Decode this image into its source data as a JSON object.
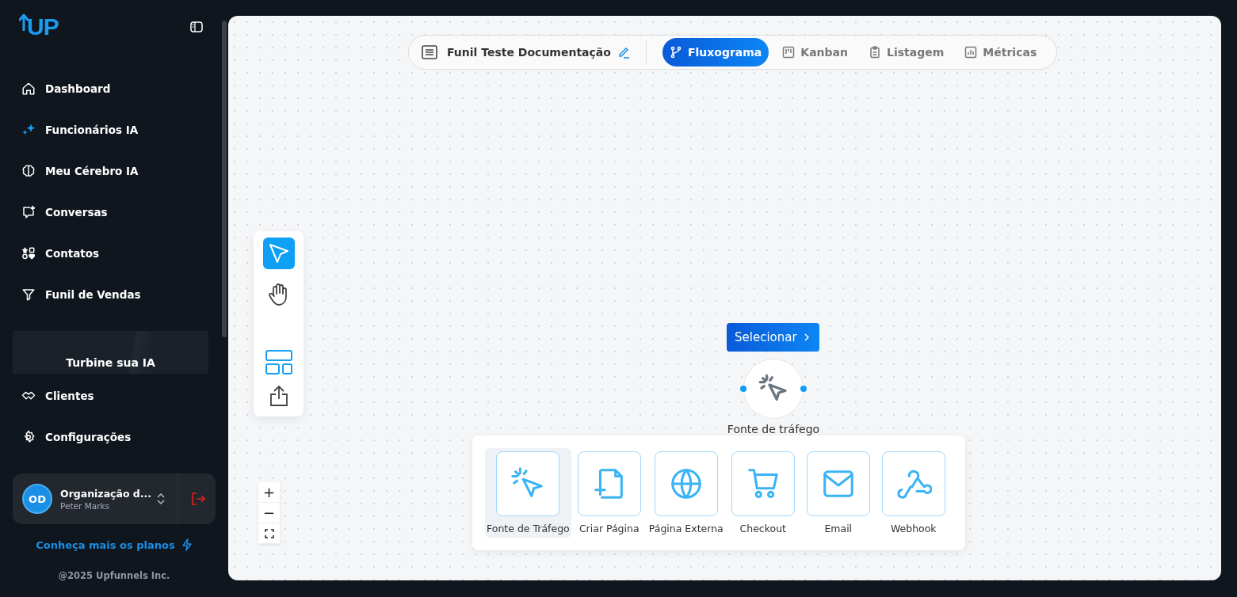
{
  "sidebar": {
    "logo": "UP",
    "items": [
      {
        "label": "Dashboard"
      },
      {
        "label": "Funcionários IA"
      },
      {
        "label": "Meu Cérebro IA"
      },
      {
        "label": "Conversas"
      },
      {
        "label": "Contatos"
      },
      {
        "label": "Funil de Vendas"
      }
    ],
    "promo": {
      "title": "Turbine sua IA"
    },
    "bottom_items": [
      {
        "label": "Clientes"
      },
      {
        "label": "Configurações"
      }
    ],
    "account": {
      "initials": "OD",
      "name": "Organização d...",
      "user": "Peter Marks"
    },
    "plans_link": "Conheça mais os planos",
    "footer": "@2025 Upfunnels Inc."
  },
  "topbar": {
    "funnel_name": "Funil Teste Documentação",
    "tabs": [
      {
        "label": "Fluxograma",
        "selected": true
      },
      {
        "label": "Kanban",
        "selected": false
      },
      {
        "label": "Listagem",
        "selected": false
      },
      {
        "label": "Métricas",
        "selected": false
      }
    ]
  },
  "tools": [
    {
      "selected": true
    },
    {
      "selected": false
    }
  ],
  "zoom": [
    "+",
    "−"
  ],
  "node": {
    "button": "Selecionar",
    "label": "Fonte de tráfego"
  },
  "palette": [
    {
      "label": "Fonte de Tráfego",
      "selected": true
    },
    {
      "label": "Criar Página",
      "selected": false
    },
    {
      "label": "Página Externa",
      "selected": false
    },
    {
      "label": "Checkout",
      "selected": false
    },
    {
      "label": "Email",
      "selected": false
    },
    {
      "label": "Webhook",
      "selected": false
    }
  ]
}
